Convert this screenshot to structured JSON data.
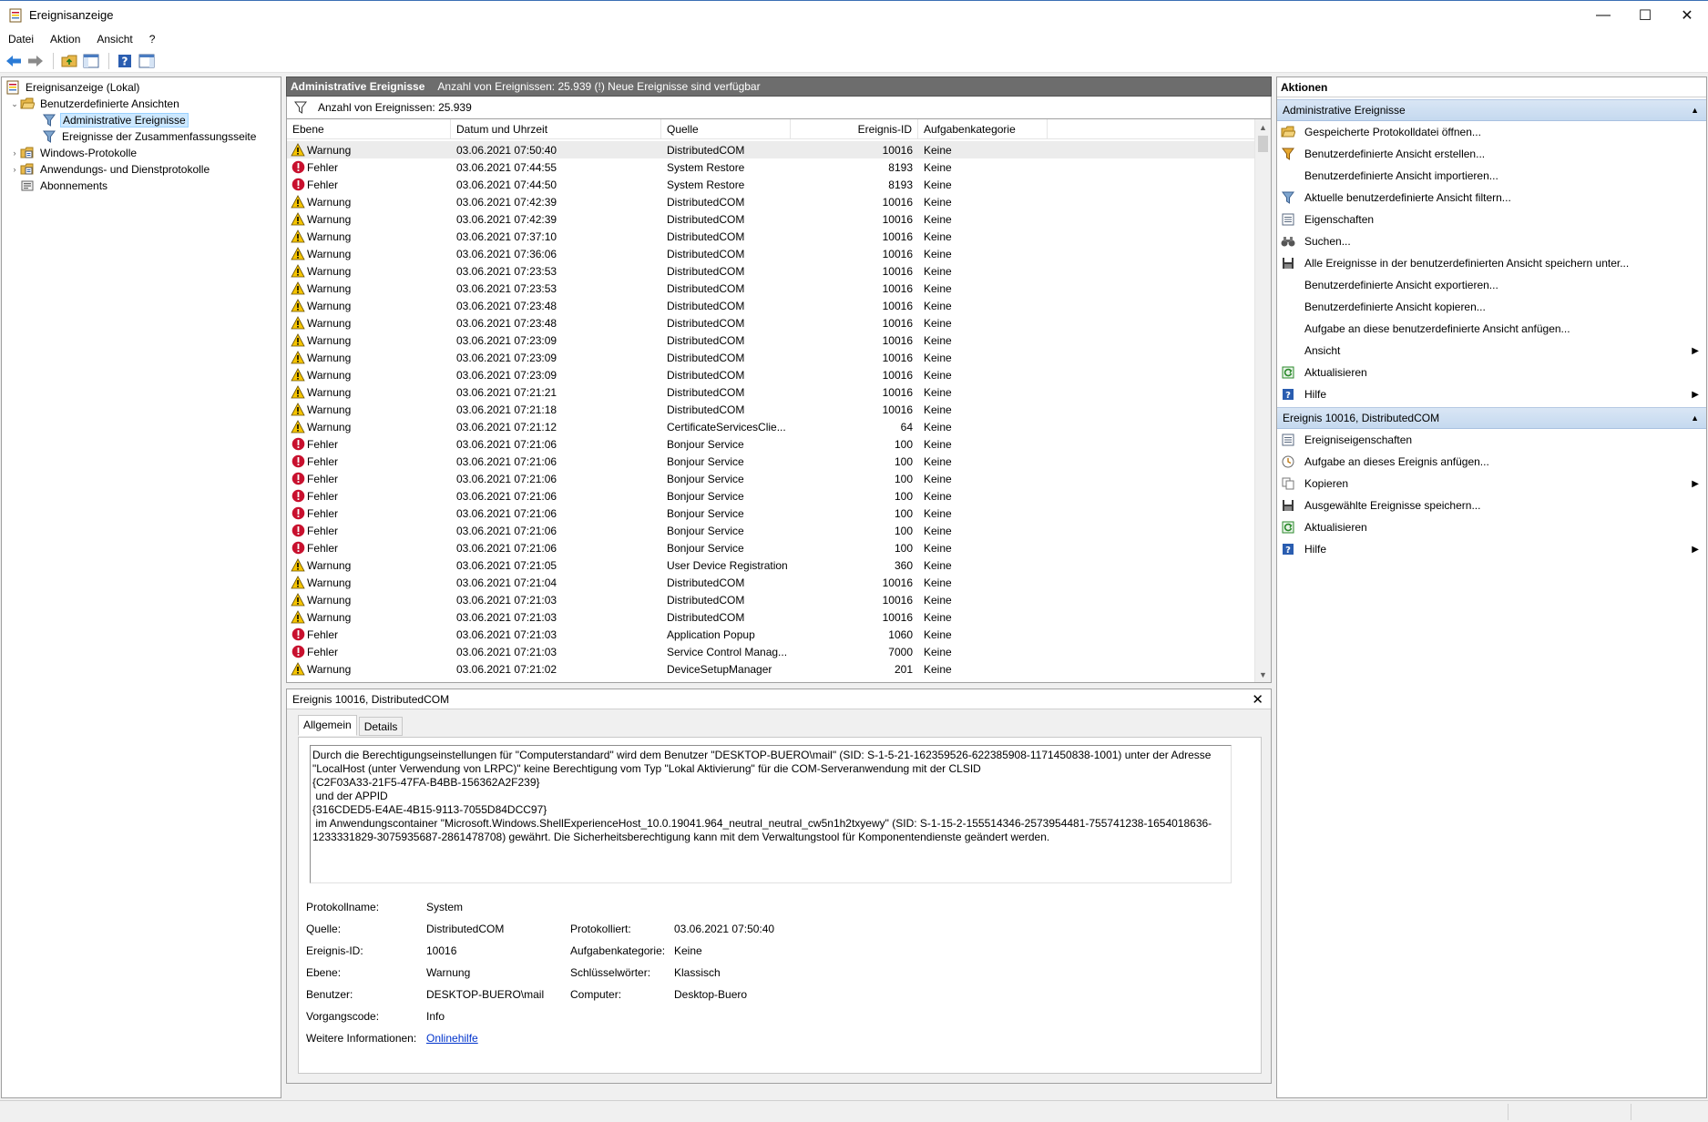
{
  "window": {
    "title": "Ereignisanzeige",
    "minimize": "—",
    "maximize": "☐",
    "close": "✕"
  },
  "menu": [
    "Datei",
    "Aktion",
    "Ansicht",
    "?"
  ],
  "tree": {
    "root": "Ereignisanzeige (Lokal)",
    "custom_views": "Benutzerdefinierte Ansichten",
    "admin_events": "Administrative Ereignisse",
    "summary_events": "Ereignisse der Zusammenfassungsseite",
    "windows_logs": "Windows-Protokolle",
    "app_logs": "Anwendungs- und Dienstprotokolle",
    "subscriptions": "Abonnements"
  },
  "main": {
    "header_title": "Administrative Ereignisse",
    "header_info": "Anzahl von Ereignissen: 25.939 (!) Neue Ereignisse sind verfügbar",
    "filter_text": "Anzahl von Ereignissen: 25.939",
    "columns": {
      "level": "Ebene",
      "datetime": "Datum und Uhrzeit",
      "source": "Quelle",
      "event_id": "Ereignis-ID",
      "category": "Aufgabenkategorie"
    },
    "rows": [
      {
        "level": "Warnung",
        "type": "warn",
        "datetime": "03.06.2021 07:50:40",
        "source": "DistributedCOM",
        "id": "10016",
        "category": "Keine"
      },
      {
        "level": "Fehler",
        "type": "err",
        "datetime": "03.06.2021 07:44:55",
        "source": "System Restore",
        "id": "8193",
        "category": "Keine"
      },
      {
        "level": "Fehler",
        "type": "err",
        "datetime": "03.06.2021 07:44:50",
        "source": "System Restore",
        "id": "8193",
        "category": "Keine"
      },
      {
        "level": "Warnung",
        "type": "warn",
        "datetime": "03.06.2021 07:42:39",
        "source": "DistributedCOM",
        "id": "10016",
        "category": "Keine"
      },
      {
        "level": "Warnung",
        "type": "warn",
        "datetime": "03.06.2021 07:42:39",
        "source": "DistributedCOM",
        "id": "10016",
        "category": "Keine"
      },
      {
        "level": "Warnung",
        "type": "warn",
        "datetime": "03.06.2021 07:37:10",
        "source": "DistributedCOM",
        "id": "10016",
        "category": "Keine"
      },
      {
        "level": "Warnung",
        "type": "warn",
        "datetime": "03.06.2021 07:36:06",
        "source": "DistributedCOM",
        "id": "10016",
        "category": "Keine"
      },
      {
        "level": "Warnung",
        "type": "warn",
        "datetime": "03.06.2021 07:23:53",
        "source": "DistributedCOM",
        "id": "10016",
        "category": "Keine"
      },
      {
        "level": "Warnung",
        "type": "warn",
        "datetime": "03.06.2021 07:23:53",
        "source": "DistributedCOM",
        "id": "10016",
        "category": "Keine"
      },
      {
        "level": "Warnung",
        "type": "warn",
        "datetime": "03.06.2021 07:23:48",
        "source": "DistributedCOM",
        "id": "10016",
        "category": "Keine"
      },
      {
        "level": "Warnung",
        "type": "warn",
        "datetime": "03.06.2021 07:23:48",
        "source": "DistributedCOM",
        "id": "10016",
        "category": "Keine"
      },
      {
        "level": "Warnung",
        "type": "warn",
        "datetime": "03.06.2021 07:23:09",
        "source": "DistributedCOM",
        "id": "10016",
        "category": "Keine"
      },
      {
        "level": "Warnung",
        "type": "warn",
        "datetime": "03.06.2021 07:23:09",
        "source": "DistributedCOM",
        "id": "10016",
        "category": "Keine"
      },
      {
        "level": "Warnung",
        "type": "warn",
        "datetime": "03.06.2021 07:23:09",
        "source": "DistributedCOM",
        "id": "10016",
        "category": "Keine"
      },
      {
        "level": "Warnung",
        "type": "warn",
        "datetime": "03.06.2021 07:21:21",
        "source": "DistributedCOM",
        "id": "10016",
        "category": "Keine"
      },
      {
        "level": "Warnung",
        "type": "warn",
        "datetime": "03.06.2021 07:21:18",
        "source": "DistributedCOM",
        "id": "10016",
        "category": "Keine"
      },
      {
        "level": "Warnung",
        "type": "warn",
        "datetime": "03.06.2021 07:21:12",
        "source": "CertificateServicesClie...",
        "id": "64",
        "category": "Keine"
      },
      {
        "level": "Fehler",
        "type": "err",
        "datetime": "03.06.2021 07:21:06",
        "source": "Bonjour Service",
        "id": "100",
        "category": "Keine"
      },
      {
        "level": "Fehler",
        "type": "err",
        "datetime": "03.06.2021 07:21:06",
        "source": "Bonjour Service",
        "id": "100",
        "category": "Keine"
      },
      {
        "level": "Fehler",
        "type": "err",
        "datetime": "03.06.2021 07:21:06",
        "source": "Bonjour Service",
        "id": "100",
        "category": "Keine"
      },
      {
        "level": "Fehler",
        "type": "err",
        "datetime": "03.06.2021 07:21:06",
        "source": "Bonjour Service",
        "id": "100",
        "category": "Keine"
      },
      {
        "level": "Fehler",
        "type": "err",
        "datetime": "03.06.2021 07:21:06",
        "source": "Bonjour Service",
        "id": "100",
        "category": "Keine"
      },
      {
        "level": "Fehler",
        "type": "err",
        "datetime": "03.06.2021 07:21:06",
        "source": "Bonjour Service",
        "id": "100",
        "category": "Keine"
      },
      {
        "level": "Fehler",
        "type": "err",
        "datetime": "03.06.2021 07:21:06",
        "source": "Bonjour Service",
        "id": "100",
        "category": "Keine"
      },
      {
        "level": "Warnung",
        "type": "warn",
        "datetime": "03.06.2021 07:21:05",
        "source": "User Device Registration",
        "id": "360",
        "category": "Keine"
      },
      {
        "level": "Warnung",
        "type": "warn",
        "datetime": "03.06.2021 07:21:04",
        "source": "DistributedCOM",
        "id": "10016",
        "category": "Keine"
      },
      {
        "level": "Warnung",
        "type": "warn",
        "datetime": "03.06.2021 07:21:03",
        "source": "DistributedCOM",
        "id": "10016",
        "category": "Keine"
      },
      {
        "level": "Warnung",
        "type": "warn",
        "datetime": "03.06.2021 07:21:03",
        "source": "DistributedCOM",
        "id": "10016",
        "category": "Keine"
      },
      {
        "level": "Fehler",
        "type": "err",
        "datetime": "03.06.2021 07:21:03",
        "source": "Application Popup",
        "id": "1060",
        "category": "Keine"
      },
      {
        "level": "Fehler",
        "type": "err",
        "datetime": "03.06.2021 07:21:03",
        "source": "Service Control Manag...",
        "id": "7000",
        "category": "Keine"
      },
      {
        "level": "Warnung",
        "type": "warn",
        "datetime": "03.06.2021 07:21:02",
        "source": "DeviceSetupManager",
        "id": "201",
        "category": "Keine"
      }
    ]
  },
  "detail": {
    "title": "Ereignis 10016, DistributedCOM",
    "tab_general": "Allgemein",
    "tab_details": "Details",
    "message": "Durch die Berechtigungseinstellungen für \"Computerstandard\" wird dem Benutzer \"DESKTOP-BUERO\\mail\" (SID: S-1-5-21-162359526-622385908-1171450838-1001) unter der Adresse\n\"LocalHost (unter Verwendung von LRPC)\" keine Berechtigung vom Typ \"Lokal Aktivierung\" für die COM-Serveranwendung mit der CLSID\n{C2F03A33-21F5-47FA-B4BB-156362A2F239}\n und der APPID\n{316CDED5-E4AE-4B15-9113-7055D84DCC97}\n im Anwendungscontainer \"Microsoft.Windows.ShellExperienceHost_10.0.19041.964_neutral_neutral_cw5n1h2txyewy\" (SID: S-1-15-2-155514346-2573954481-755741238-1654018636-\n1233331829-3075935687-2861478708) gewährt. Die Sicherheitsberechtigung kann mit dem Verwaltungstool für Komponentendienste geändert werden.",
    "labels": {
      "log_name": "Protokollname:",
      "source": "Quelle:",
      "event_id": "Ereignis-ID:",
      "level": "Ebene:",
      "user": "Benutzer:",
      "opcode": "Vorgangscode:",
      "more_info": "Weitere Informationen:",
      "logged": "Protokolliert:",
      "task_category": "Aufgabenkategorie:",
      "keywords": "Schlüsselwörter:",
      "computer": "Computer:"
    },
    "values": {
      "log_name": "System",
      "source": "DistributedCOM",
      "event_id": "10016",
      "level": "Warnung",
      "user": "DESKTOP-BUERO\\mail",
      "opcode": "Info",
      "more_info": "Onlinehilfe",
      "logged": "03.06.2021 07:50:40",
      "task_category": "Keine",
      "keywords": "Klassisch",
      "computer": "Desktop-Buero"
    }
  },
  "actions": {
    "title": "Aktionen",
    "section1": "Administrative Ereignisse",
    "items1": [
      {
        "label": "Gespeicherte Protokolldatei öffnen...",
        "icon": "folder-open-icon"
      },
      {
        "label": "Benutzerdefinierte Ansicht erstellen...",
        "icon": "filter-create-icon"
      },
      {
        "label": "Benutzerdefinierte Ansicht importieren...",
        "icon": ""
      },
      {
        "label": "Aktuelle benutzerdefinierte Ansicht filtern...",
        "icon": "filter-icon"
      },
      {
        "label": "Eigenschaften",
        "icon": "properties-icon"
      },
      {
        "label": "Suchen...",
        "icon": "binoculars-icon"
      },
      {
        "label": "Alle Ereignisse in der benutzerdefinierten Ansicht speichern unter...",
        "icon": "save-icon"
      },
      {
        "label": "Benutzerdefinierte Ansicht exportieren...",
        "icon": ""
      },
      {
        "label": "Benutzerdefinierte Ansicht kopieren...",
        "icon": ""
      },
      {
        "label": "Aufgabe an diese benutzerdefinierte Ansicht anfügen...",
        "icon": ""
      },
      {
        "label": "Ansicht",
        "icon": "",
        "submenu": true
      },
      {
        "label": "Aktualisieren",
        "icon": "refresh-icon"
      },
      {
        "label": "Hilfe",
        "icon": "help-icon",
        "submenu": true
      }
    ],
    "section2": "Ereignis 10016, DistributedCOM",
    "items2": [
      {
        "label": "Ereigniseigenschaften",
        "icon": "properties-icon"
      },
      {
        "label": "Aufgabe an dieses Ereignis anfügen...",
        "icon": "task-icon"
      },
      {
        "label": "Kopieren",
        "icon": "copy-icon",
        "submenu": true
      },
      {
        "label": "Ausgewählte Ereignisse speichern...",
        "icon": "save-icon"
      },
      {
        "label": "Aktualisieren",
        "icon": "refresh-icon"
      },
      {
        "label": "Hilfe",
        "icon": "help-icon",
        "submenu": true
      }
    ]
  },
  "colors": {
    "warning": "#f5c400",
    "error": "#c8102e",
    "selection": "#cce8ff",
    "header_bg": "#6d6d6d",
    "section_bg": "#c5d9ef",
    "link": "#0033cc"
  }
}
